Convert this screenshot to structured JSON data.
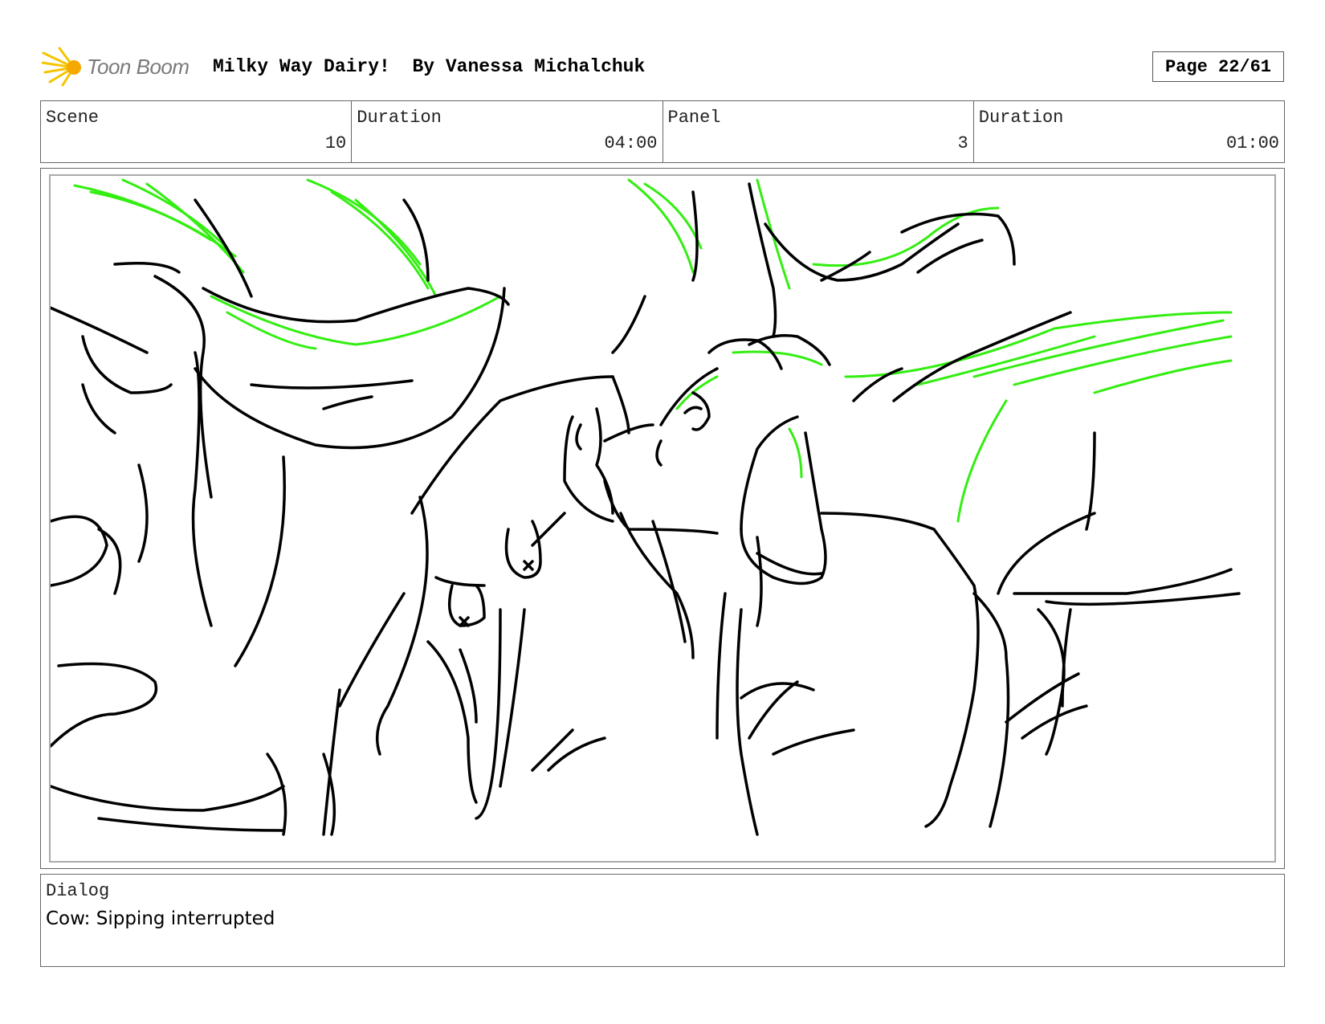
{
  "header": {
    "logo_text": "Toon Boom",
    "title": "Milky Way Dairy!  By Vanessa Michalchuk",
    "page": "Page 22/61"
  },
  "info": {
    "scene_label": "Scene",
    "scene_value": "10",
    "scene_duration_label": "Duration",
    "scene_duration_value": "04:00",
    "panel_label": "Panel",
    "panel_value": "3",
    "panel_duration_label": "Duration",
    "panel_duration_value": "01:00"
  },
  "dialog": {
    "label": "Dialog",
    "text": "Cow: Sipping interrupted"
  },
  "colors": {
    "ink": "#000000",
    "highlight": "#33ee11",
    "logo_burst": "#f5c400"
  }
}
